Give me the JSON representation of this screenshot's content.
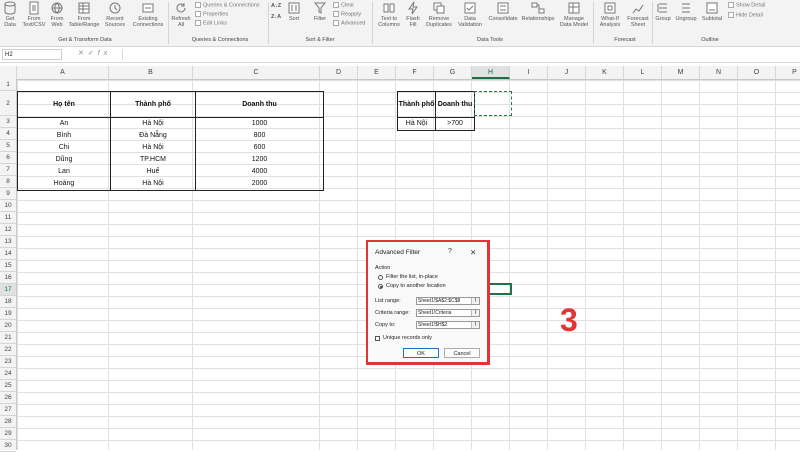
{
  "ribbon": {
    "get_data": "Get Data",
    "from_text_csv": "From Text/CSV",
    "from_web": "From Web",
    "from_table_range": "From Table/Range",
    "recent_sources": "Recent Sources",
    "existing_connections": "Existing Connections",
    "refresh_all": "Refresh All",
    "queries_connections": "Queries & Connections",
    "properties": "Properties",
    "edit_links": "Edit Links",
    "sort_az": "A↓Z",
    "sort_za": "Z↓A",
    "sort": "Sort",
    "filter": "Filter",
    "clear": "Clear",
    "reapply": "Reapply",
    "advanced": "Advanced",
    "text_to_columns": "Text to Columns",
    "flash_fill": "Flash Fill",
    "remove_duplicates": "Remove Duplicates",
    "data_validation": "Data Validation",
    "consolidate": "Consolidate",
    "relationships": "Relationships",
    "manage_data_model": "Manage Data Model",
    "what_if": "What-If Analysis",
    "forecast_sheet": "Forecast Sheet",
    "group": "Group",
    "ungroup": "Ungroup",
    "subtotal": "Subtotal",
    "show_detail": "Show Detail",
    "hide_detail": "Hide Detail",
    "groups": {
      "get_transform": "Get & Transform Data",
      "queries": "Queries & Connections",
      "sort_filter": "Sort & Filter",
      "data_tools": "Data Tools",
      "forecast": "Forecast",
      "outline": "Outline"
    }
  },
  "formula_bar": {
    "name_box": "H2",
    "formula": ""
  },
  "columns": [
    "A",
    "B",
    "C",
    "D",
    "E",
    "F",
    "G",
    "H",
    "I",
    "J",
    "K",
    "L",
    "M",
    "N",
    "O",
    "P"
  ],
  "rows": [
    "1",
    "2",
    "3",
    "4",
    "5",
    "6",
    "7",
    "8",
    "9",
    "10",
    "11",
    "12",
    "13",
    "14",
    "15",
    "16",
    "17",
    "18",
    "19",
    "20",
    "21",
    "22",
    "23",
    "24",
    "25",
    "26",
    "27",
    "28",
    "29",
    "30"
  ],
  "main_table": {
    "headers": [
      "Họ tên",
      "Thành phố",
      "Doanh thu"
    ],
    "rows": [
      [
        "An",
        "Hà Nội",
        "1000"
      ],
      [
        "Bình",
        "Đà Nẵng",
        "800"
      ],
      [
        "Chi",
        "Hà Nội",
        "600"
      ],
      [
        "Dũng",
        "TP.HCM",
        "1200"
      ],
      [
        "Lan",
        "Huế",
        "4000"
      ],
      [
        "Hoàng",
        "Hà Nội",
        "2000"
      ]
    ]
  },
  "criteria_table": {
    "headers": [
      "Thành phố",
      "Doanh thu"
    ],
    "row": [
      "Hà Nội",
      ">700"
    ]
  },
  "dialog": {
    "title": "Advanced Filter",
    "help": "?",
    "close": "✕",
    "action_label": "Action",
    "option_inplace": "Filter the list, in-place",
    "option_copy": "Copy to another location",
    "list_range_label": "List range:",
    "list_range_value": "Sheet1!$A$2:$C$8",
    "criteria_range_label": "Criteria range:",
    "criteria_range_value": "Sheet1!Criteria",
    "copy_to_label": "Copy to:",
    "copy_to_value": "Sheet1!$H$2",
    "unique_label": "Unique records only",
    "ok": "OK",
    "cancel": "Cancel"
  },
  "step_number": "3",
  "colors": {
    "accent_red": "#e03535",
    "excel_green": "#217346"
  }
}
